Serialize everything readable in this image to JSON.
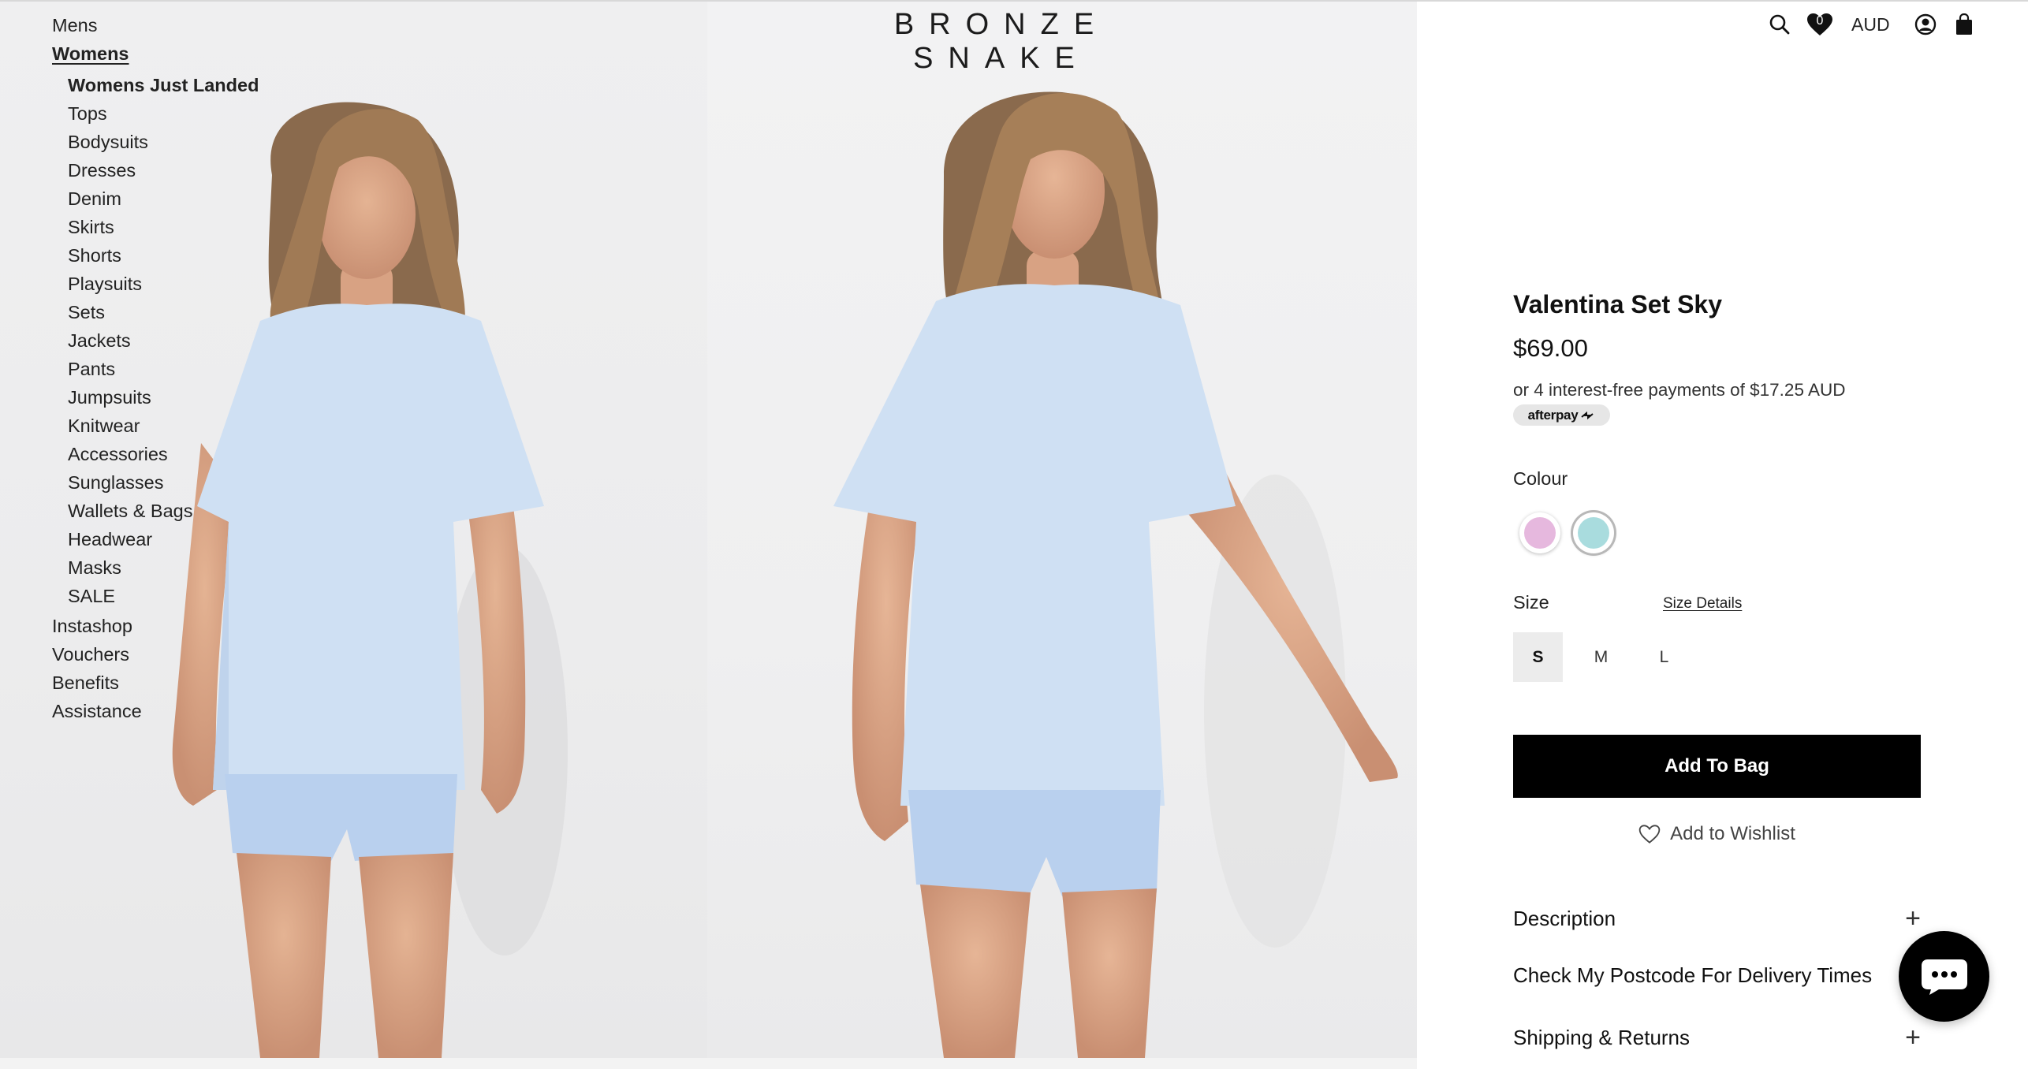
{
  "brand": {
    "logo": "BRONZE SNAKE"
  },
  "nav": {
    "top": [
      {
        "label": "Mens"
      },
      {
        "label": "Womens"
      }
    ],
    "womens_sub": [
      "Womens Just Landed",
      "Tops",
      "Bodysuits",
      "Dresses",
      "Denim",
      "Skirts",
      "Shorts",
      "Playsuits",
      "Sets",
      "Jackets",
      "Pants",
      "Jumpsuits",
      "Knitwear",
      "Accessories",
      "Sunglasses",
      "Wallets & Bags",
      "Headwear",
      "Masks",
      "SALE"
    ],
    "bottom": [
      "Instashop",
      "Vouchers",
      "Benefits",
      "Assistance"
    ]
  },
  "header": {
    "wishlist_count": "0",
    "currency": "AUD",
    "icons": [
      "search-icon",
      "heart-icon",
      "account-icon",
      "bag-icon"
    ]
  },
  "product": {
    "title": "Valentina Set Sky",
    "price": "$69.00",
    "afterpay_text": "or 4 interest-free payments of $17.25 AUD",
    "afterpay_badge": "afterpay",
    "colour_label": "Colour",
    "colours": [
      {
        "name": "pink",
        "hex": "#e6b8de",
        "selected": false
      },
      {
        "name": "sky",
        "hex": "#a9dcde",
        "selected": true
      }
    ],
    "size_label": "Size",
    "size_details": "Size Details",
    "sizes": [
      {
        "label": "S",
        "selected": true
      },
      {
        "label": "M",
        "selected": false
      },
      {
        "label": "L",
        "selected": false
      }
    ],
    "add_to_bag": "Add To Bag",
    "add_to_wishlist": "Add to Wishlist",
    "accordions": [
      {
        "label": "Description",
        "icon": "plus-icon"
      },
      {
        "label": "Check My Postcode For Delivery Times",
        "icon": ""
      },
      {
        "label": "Shipping & Returns",
        "icon": "plus-icon"
      }
    ]
  },
  "chat": {
    "icon": "chat-bubble-icon"
  },
  "colors": {
    "black": "#000000",
    "shirt": "#cfe0f3",
    "background": "#ffffff"
  }
}
